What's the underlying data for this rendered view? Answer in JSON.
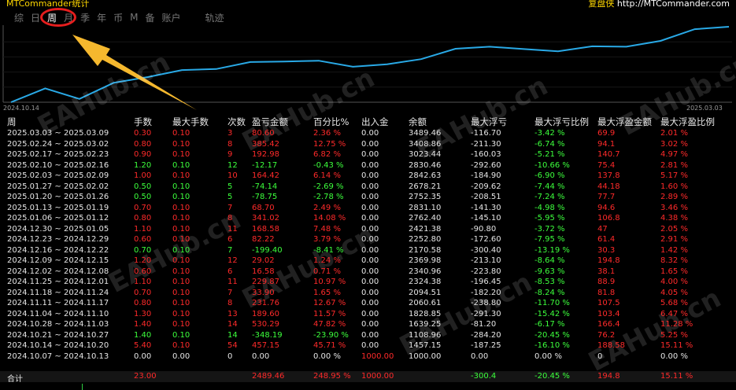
{
  "app": {
    "title": "MTCommander统计",
    "right_label": "复盘侠",
    "right_url": "http://MTCommander.com"
  },
  "tabs": [
    {
      "label": "综"
    },
    {
      "label": "日"
    },
    {
      "label": "周"
    },
    {
      "label": "月"
    },
    {
      "label": "季"
    },
    {
      "label": "年"
    },
    {
      "label": "币"
    },
    {
      "label": "M"
    },
    {
      "label": "备"
    },
    {
      "label": "账户"
    },
    {
      "label": "轨迹"
    }
  ],
  "active_tab": "周",
  "chart": {
    "start_date": "2024.10.14",
    "end_date": "2025.03.03",
    "line_color": "#29a9e6",
    "series_values": [
      1000.0,
      1457.15,
      1108.96,
      1639.25,
      1828.85,
      2060.61,
      2094.51,
      2324.38,
      2340.96,
      2369.98,
      2170.58,
      2252.8,
      2421.38,
      2762.4,
      2831.1,
      2752.35,
      2678.21,
      2842.63,
      2830.46,
      3023.44,
      3408.86,
      3489.46
    ]
  },
  "table": {
    "headers": [
      "周",
      "手数",
      "最大手数",
      "次数",
      "盈亏金额",
      "百分比%",
      "出入金",
      "余额",
      "最大浮亏",
      "最大浮亏比例",
      "最大浮盈金额",
      "最大浮盈比例"
    ],
    "rows": [
      [
        "2025.03.03 ~ 2025.03.09",
        "0.30",
        "0.10",
        "3",
        "80.60",
        "2.36 %",
        "0.00",
        "3489.46",
        "-116.70",
        "-3.42 %",
        "69.9",
        "2.01 %"
      ],
      [
        "2025.02.24 ~ 2025.03.02",
        "0.80",
        "0.10",
        "8",
        "385.42",
        "12.75 %",
        "0.00",
        "3408.86",
        "-211.30",
        "-6.74 %",
        "94.1",
        "3.02 %"
      ],
      [
        "2025.02.17 ~ 2025.02.23",
        "0.90",
        "0.10",
        "9",
        "192.98",
        "6.82 %",
        "0.00",
        "3023.44",
        "-160.03",
        "-5.21 %",
        "140.7",
        "4.97 %"
      ],
      [
        "2025.02.10 ~ 2025.02.16",
        "1.20",
        "0.10",
        "12",
        "-12.17",
        "-0.43 %",
        "0.00",
        "2830.46",
        "-292.60",
        "-10.66 %",
        "75.4",
        "2.81 %"
      ],
      [
        "2025.02.03 ~ 2025.02.09",
        "1.00",
        "0.10",
        "10",
        "164.42",
        "6.14 %",
        "0.00",
        "2842.63",
        "-184.90",
        "-6.90 %",
        "137.8",
        "5.17 %"
      ],
      [
        "2025.01.27 ~ 2025.02.02",
        "0.50",
        "0.10",
        "5",
        "-74.14",
        "-2.69 %",
        "0.00",
        "2678.21",
        "-209.62",
        "-7.44 %",
        "44.18",
        "1.60 %"
      ],
      [
        "2025.01.20 ~ 2025.01.26",
        "0.50",
        "0.10",
        "5",
        "-78.75",
        "-2.78 %",
        "0.00",
        "2752.35",
        "-208.51",
        "-7.24 %",
        "77.7",
        "2.89 %"
      ],
      [
        "2025.01.13 ~ 2025.01.19",
        "0.70",
        "0.10",
        "7",
        "68.70",
        "2.49 %",
        "0.00",
        "2831.10",
        "-141.30",
        "-4.98 %",
        "94.6",
        "3.46 %"
      ],
      [
        "2025.01.06 ~ 2025.01.12",
        "0.80",
        "0.10",
        "8",
        "341.02",
        "14.08 %",
        "0.00",
        "2762.40",
        "-145.10",
        "-5.95 %",
        "106.8",
        "4.38 %"
      ],
      [
        "2024.12.30 ~ 2025.01.05",
        "1.10",
        "0.10",
        "11",
        "168.58",
        "7.48 %",
        "0.00",
        "2421.38",
        "-90.80",
        "-3.72 %",
        "47",
        "2.05 %"
      ],
      [
        "2024.12.23 ~ 2024.12.29",
        "0.60",
        "0.10",
        "6",
        "82.22",
        "3.79 %",
        "0.00",
        "2252.80",
        "-172.60",
        "-7.95 %",
        "61.4",
        "2.91 %"
      ],
      [
        "2024.12.16 ~ 2024.12.22",
        "0.70",
        "0.10",
        "7",
        "-199.40",
        "-8.41 %",
        "0.00",
        "2170.58",
        "-300.40",
        "-13.19 %",
        "30.3",
        "1.42 %"
      ],
      [
        "2024.12.09 ~ 2024.12.15",
        "1.20",
        "0.10",
        "12",
        "29.02",
        "1.24 %",
        "0.00",
        "2369.98",
        "-213.10",
        "-8.64 %",
        "194.8",
        "8.32 %"
      ],
      [
        "2024.12.02 ~ 2024.12.08",
        "0.60",
        "0.10",
        "6",
        "16.58",
        "0.71 %",
        "0.00",
        "2340.96",
        "-223.80",
        "-9.63 %",
        "38.1",
        "1.65 %"
      ],
      [
        "2024.11.25 ~ 2024.12.01",
        "1.10",
        "0.10",
        "11",
        "229.87",
        "10.97 %",
        "0.00",
        "2324.38",
        "-196.45",
        "-8.53 %",
        "88.9",
        "4.00 %"
      ],
      [
        "2024.11.18 ~ 2024.11.24",
        "0.70",
        "0.10",
        "7",
        "33.90",
        "1.65 %",
        "0.00",
        "2094.51",
        "-182.20",
        "-8.24 %",
        "81.8",
        "4.05 %"
      ],
      [
        "2024.11.11 ~ 2024.11.17",
        "0.80",
        "0.10",
        "8",
        "231.76",
        "12.67 %",
        "0.00",
        "2060.61",
        "-238.80",
        "-11.70 %",
        "107.5",
        "5.68 %"
      ],
      [
        "2024.11.04 ~ 2024.11.10",
        "1.30",
        "0.10",
        "13",
        "189.60",
        "11.57 %",
        "0.00",
        "1828.85",
        "-291.30",
        "-15.42 %",
        "103.4",
        "6.47 %"
      ],
      [
        "2024.10.28 ~ 2024.11.03",
        "1.40",
        "0.10",
        "14",
        "530.29",
        "47.82 %",
        "0.00",
        "1639.25",
        "-81.20",
        "-6.17 %",
        "166.4",
        "11.28 %"
      ],
      [
        "2024.10.21 ~ 2024.10.27",
        "1.40",
        "0.10",
        "14",
        "-348.19",
        "-23.90 %",
        "0.00",
        "1108.96",
        "-284.20",
        "-20.45 %",
        "76.2",
        "5.25 %"
      ],
      [
        "2024.10.14 ~ 2024.10.20",
        "5.40",
        "0.10",
        "54",
        "457.15",
        "45.71 %",
        "0.00",
        "1457.15",
        "-187.25",
        "-16.10 %",
        "188.58",
        "15.11 %"
      ],
      [
        "2024.10.07 ~ 2024.10.13",
        "0.00",
        "0.00",
        "0",
        "0.00",
        "0.00 %",
        "1000.00",
        "1000.00",
        "0.00",
        "0.00 %",
        "0",
        "0.00 %"
      ]
    ],
    "total": [
      "合计",
      "23.00",
      "",
      "",
      "2489.46",
      "248.95 %",
      "1000.00",
      "",
      "-300.4",
      "-20.45 %",
      "194.8",
      "15.11 %"
    ]
  },
  "watermark": "EAHub.cn",
  "colors": {
    "positive": "#ff2a2a",
    "negative": "#3cff3c",
    "neutral": "#e6e6e6",
    "header": "#e8e8e8"
  }
}
